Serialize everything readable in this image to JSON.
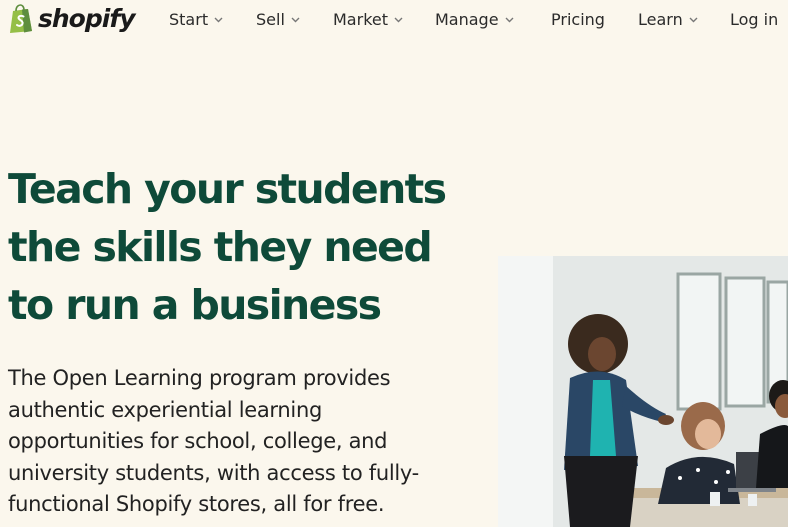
{
  "brand": {
    "name": "shopify",
    "accent": "#95bf47",
    "heading_color": "#0e4a39"
  },
  "nav": {
    "items": [
      {
        "label": "Start",
        "dropdown": true
      },
      {
        "label": "Sell",
        "dropdown": true
      },
      {
        "label": "Market",
        "dropdown": true
      },
      {
        "label": "Manage",
        "dropdown": true
      },
      {
        "label": "Pricing",
        "dropdown": false
      },
      {
        "label": "Learn",
        "dropdown": true
      },
      {
        "label": "Log in",
        "dropdown": false
      }
    ]
  },
  "hero": {
    "title_lines": [
      "Teach your students",
      "the skills they need",
      "to run a business"
    ],
    "desc_lines": [
      "The Open Learning program provides",
      "authentic experiential learning",
      "opportunities for school, college, and",
      "university students, with access to fully-",
      "functional Shopify stores, all for free."
    ]
  },
  "icons": {
    "logo": "shopify-bag-icon",
    "dropdown": "chevron-down-icon"
  }
}
